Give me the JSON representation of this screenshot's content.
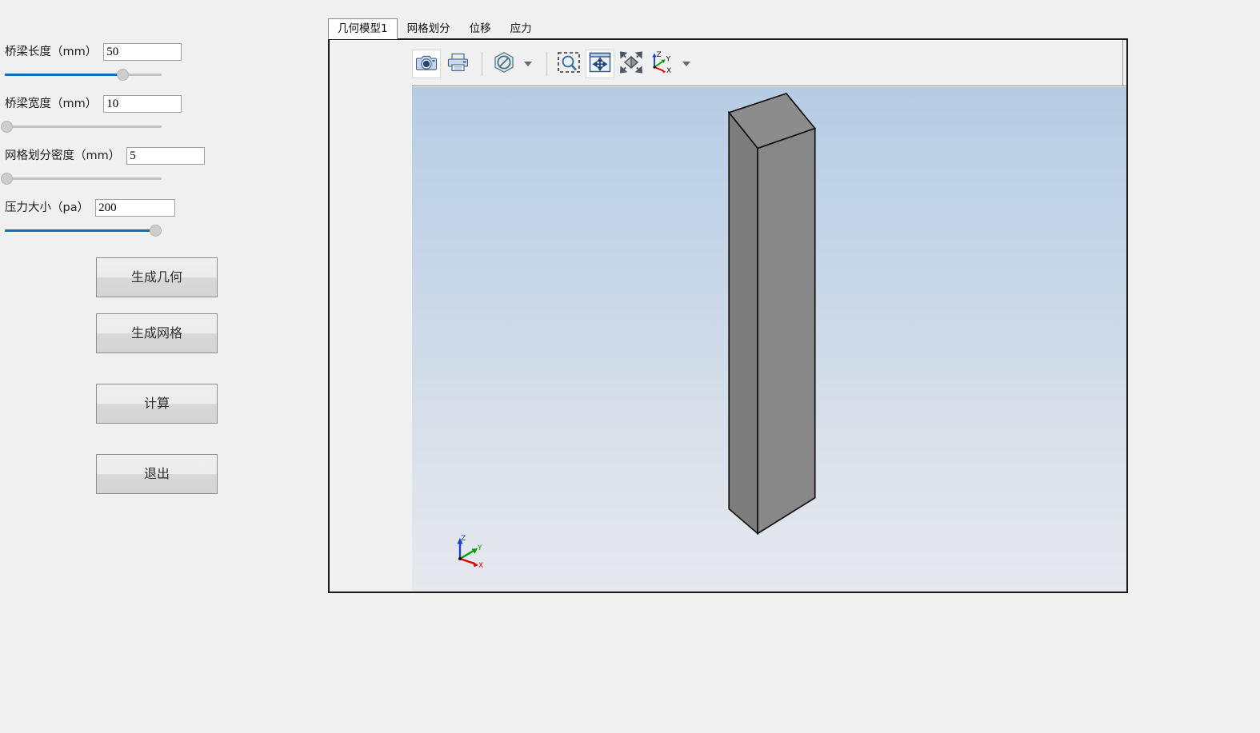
{
  "parameters": [
    {
      "label": "桥梁长度（mm）",
      "value": "50",
      "placeholder": "",
      "slider_percent": 75,
      "slider_filled": true,
      "name": "bridge-length"
    },
    {
      "label": "桥梁宽度（mm）",
      "value": "10",
      "placeholder": "",
      "slider_percent": 1,
      "slider_filled": false,
      "name": "bridge-width"
    },
    {
      "label": "网格划分密度（mm）",
      "value": "5",
      "placeholder": "",
      "slider_percent": 1,
      "slider_filled": false,
      "name": "mesh-density"
    },
    {
      "label": "压力大小（pa）",
      "value": "200",
      "placeholder": "",
      "slider_percent": 96,
      "slider_filled": true,
      "name": "pressure-magnitude"
    }
  ],
  "buttons": [
    {
      "label": "生成几何",
      "name": "generate-geometry"
    },
    {
      "label": "生成网格",
      "name": "generate-mesh"
    },
    {
      "label": "计算",
      "name": "compute"
    },
    {
      "label": "退出",
      "name": "exit"
    }
  ],
  "tabs": [
    {
      "label": "几何模型1",
      "active": true,
      "name": "tab-geometry-model"
    },
    {
      "label": "网格划分",
      "active": false,
      "name": "tab-mesh"
    },
    {
      "label": "位移",
      "active": false,
      "name": "tab-displacement"
    },
    {
      "label": "应力",
      "active": false,
      "name": "tab-stress"
    }
  ],
  "toolbar": {
    "items": [
      {
        "icon": "camera-icon",
        "label": "截图"
      },
      {
        "icon": "printer-icon",
        "label": "打印"
      },
      {
        "icon": "no-clip-icon",
        "label": "剖切"
      },
      {
        "icon": "zoom-box-icon",
        "label": "框选缩放"
      },
      {
        "icon": "pan-icon",
        "label": "平移"
      },
      {
        "icon": "fit-view-icon",
        "label": "适应视图"
      },
      {
        "icon": "axis-triad-icon",
        "label": "视角"
      }
    ]
  },
  "viewport": {
    "axis_labels": {
      "x": "X",
      "y": "Y",
      "z": "Z"
    },
    "axis_colors": {
      "x": "#e00000",
      "y": "#00a000",
      "z": "#1b3fd4"
    },
    "background_top": "#b6cce4",
    "background_bottom": "#e7e9ee",
    "model_face_color": "#808080",
    "model_edge_color": "#111111"
  },
  "colors": {
    "accent": "#0d6ebf",
    "panel": "#f0f0f0",
    "border": "#8a8a8a"
  }
}
